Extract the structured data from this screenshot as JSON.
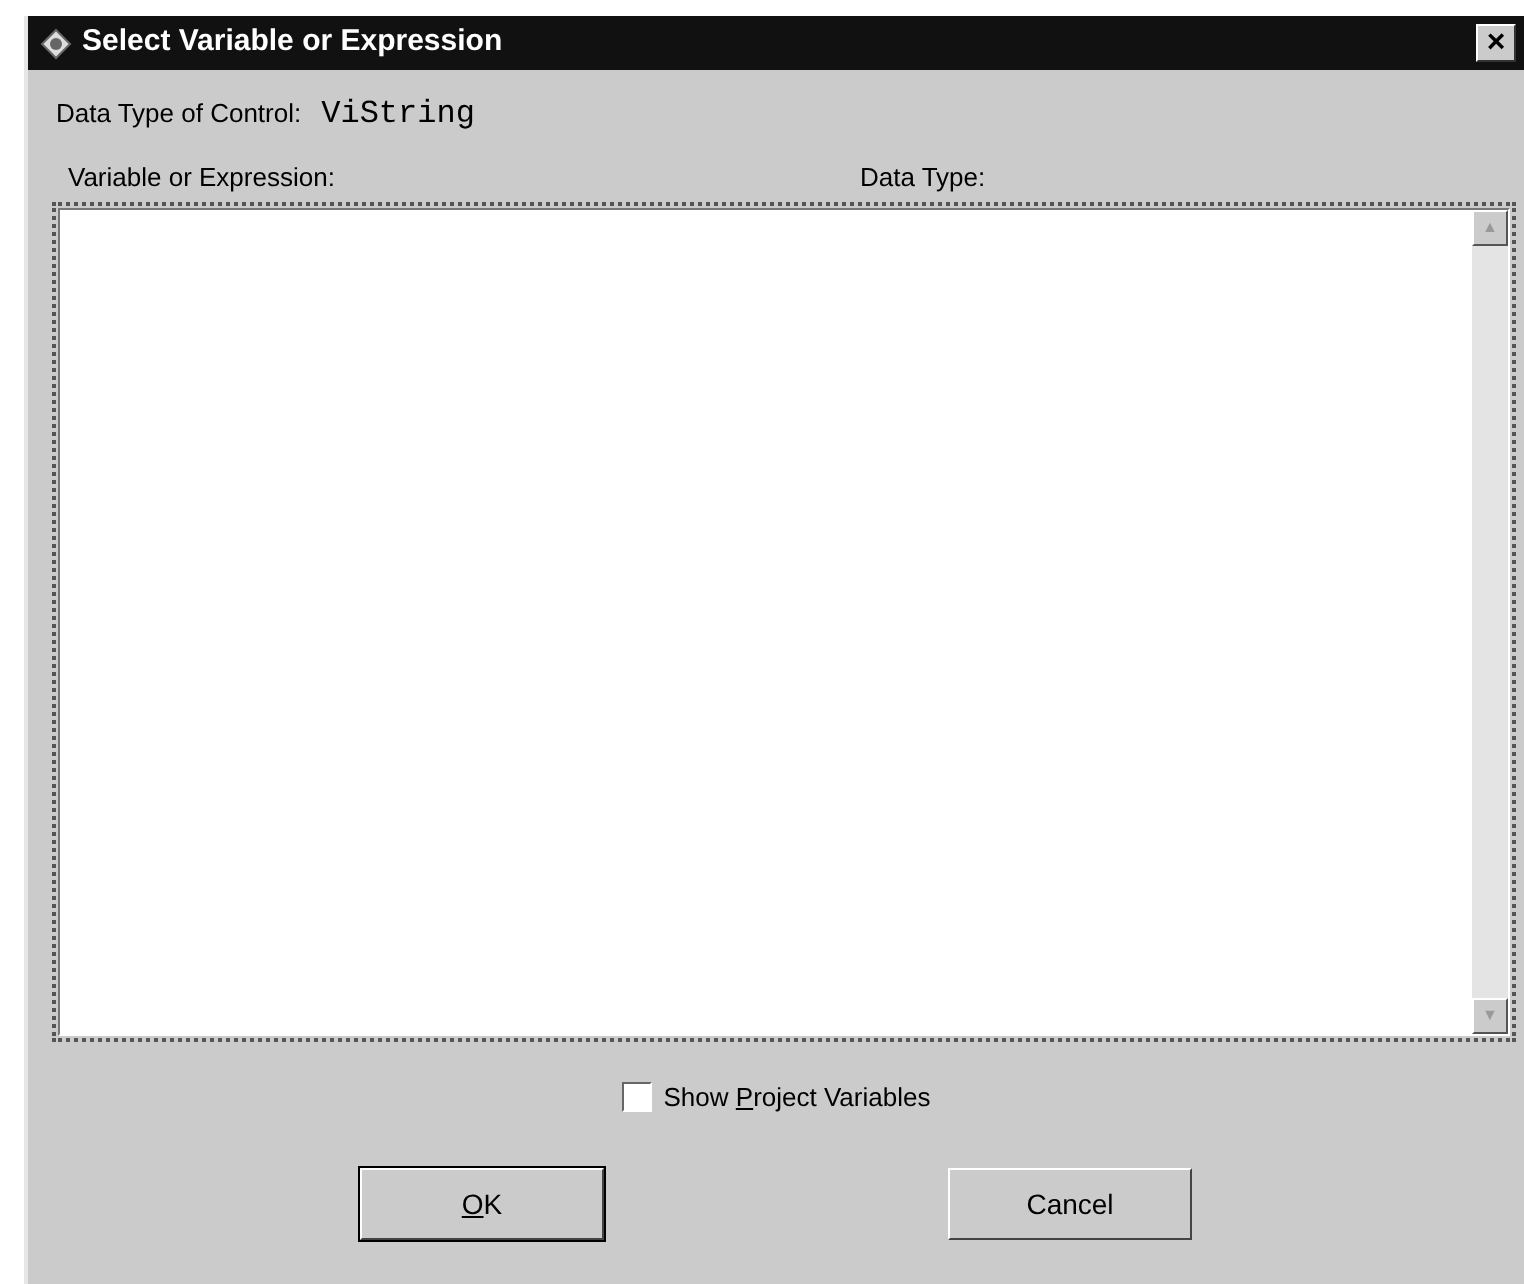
{
  "window": {
    "title": "Select Variable or Expression",
    "close": "×"
  },
  "data_type": {
    "label": "Data Type of Control:",
    "value": "ViString"
  },
  "list": {
    "columns": [
      "Variable or Expression:",
      "Data Type:"
    ],
    "scroll_up": "▲",
    "scroll_down": "▼"
  },
  "show_project_variables": {
    "label_before": "Show ",
    "access_key": "P",
    "label_after": "roject Variables",
    "checked": false
  },
  "buttons": [
    {
      "access_key": "O",
      "label_after": "K",
      "default": true
    },
    {
      "label_before": "Cancel",
      "default": false
    }
  ]
}
